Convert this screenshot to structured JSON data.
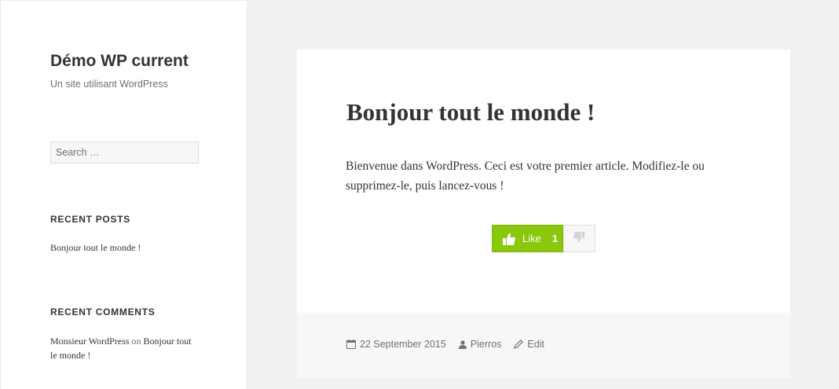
{
  "site": {
    "title": "Démo WP current",
    "description": "Un site utilisant WordPress"
  },
  "search": {
    "placeholder": "Search …"
  },
  "widgets": {
    "recent_posts": {
      "title": "RECENT POSTS",
      "items": [
        "Bonjour tout le monde !"
      ]
    },
    "recent_comments": {
      "title": "RECENT COMMENTS",
      "items": [
        {
          "author": "Monsieur WordPress",
          "connector": "on",
          "post": "Bonjour tout le monde !"
        }
      ]
    }
  },
  "post": {
    "title": "Bonjour tout le monde !",
    "content": "Bienvenue dans WordPress. Ceci est votre premier article. Modifiez-le ou supprimez-le, puis lancez-vous !",
    "like": {
      "label": "Like",
      "count": "1"
    },
    "meta": {
      "date": "22 September 2015",
      "author": "Pierros",
      "edit_label": "Edit"
    }
  },
  "colors": {
    "like_green": "#8bc70d",
    "text": "#333333",
    "muted": "#707070",
    "background": "#f1f1f1"
  },
  "icons": {
    "like": "thumbs-up-icon",
    "dislike": "thumbs-down-icon",
    "date": "calendar-icon",
    "author": "user-icon",
    "edit": "pencil-icon"
  }
}
